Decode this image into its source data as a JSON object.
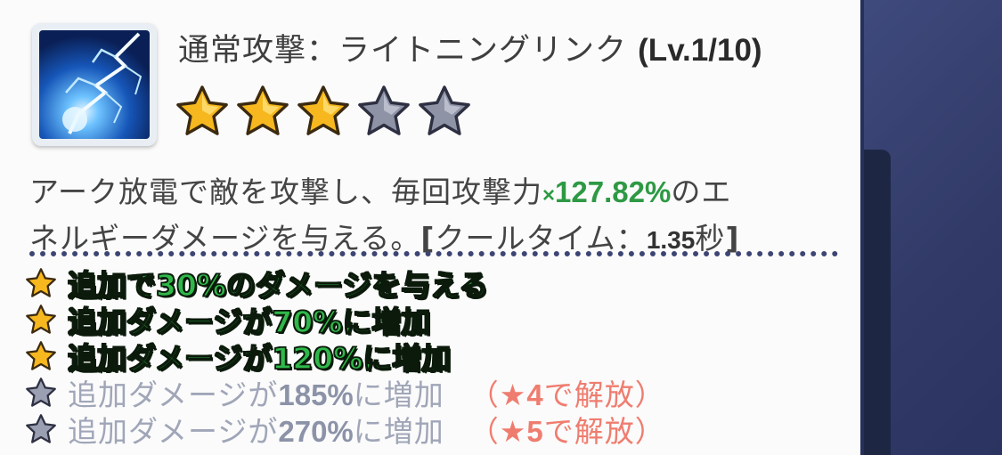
{
  "skill": {
    "name": "通常攻撃：ライトニングリンク",
    "level": "(Lv.1/10)",
    "icon": "lightning-link-skill-icon",
    "rating": 3,
    "max_rating": 5
  },
  "description": {
    "line1_pre": "アーク放電で敵を攻撃し、毎回攻撃力",
    "multiplier_sign": "×",
    "multiplier": "127.82%",
    "line1_post": "のエ",
    "line2_pre": "ネルギーダメージを与える。",
    "bracket_open": "[",
    "cooldown_label": "クールタイム：",
    "cooldown_value": "1.35",
    "cooldown_unit": "秒",
    "bracket_close": "]"
  },
  "effects": [
    {
      "text": "追加で30%のダメージを与える",
      "unlocked": true
    },
    {
      "text": "追加ダメージが70%に増加",
      "unlocked": true
    },
    {
      "text": "追加ダメージが120%に増加",
      "unlocked": true
    },
    {
      "pre": "追加ダメージが",
      "pct": "185%",
      "post": "に増加",
      "lock_open": "（★",
      "lock_num": "4",
      "lock_post": "で解放）",
      "unlocked": false
    },
    {
      "pre": "追加ダメージが",
      "pct": "270%",
      "post": "に増加",
      "lock_open": "（★",
      "lock_num": "5",
      "lock_post": "で解放）",
      "unlocked": false
    }
  ],
  "colors": {
    "highlight_green": "#2e9944",
    "effect_green": "#2fb84a",
    "lock_red": "#ef7d6f",
    "star_gold": "#f6b81e",
    "star_gray": "#8e93a6"
  }
}
